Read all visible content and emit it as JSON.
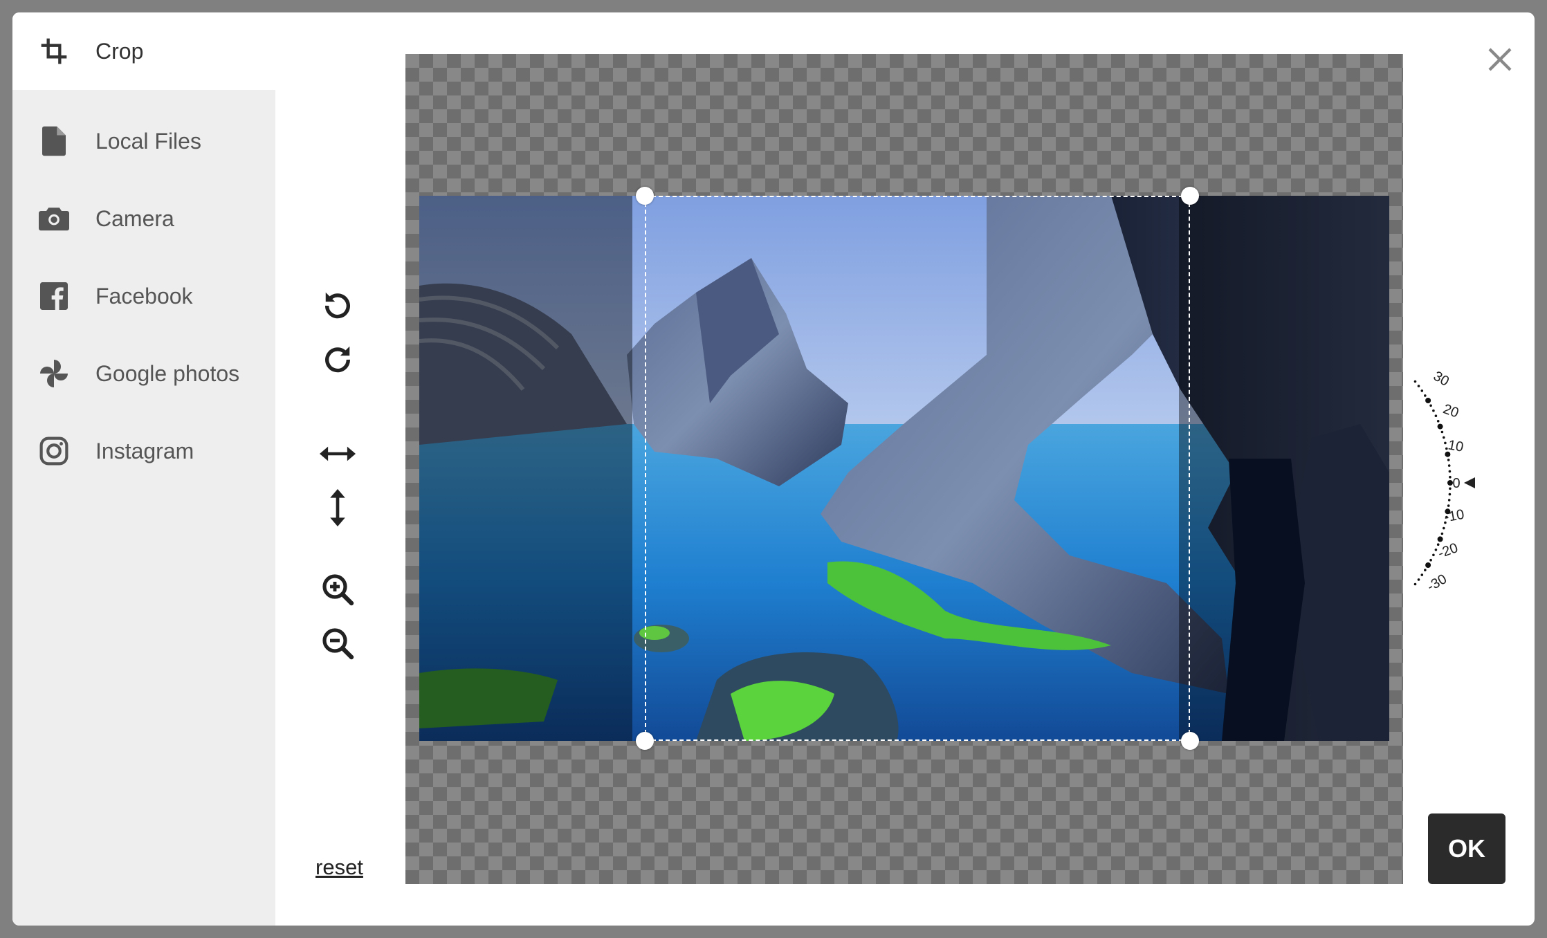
{
  "sidebar": {
    "items": [
      {
        "label": "Crop",
        "icon": "crop-icon",
        "active": true
      },
      {
        "label": "Local Files",
        "icon": "file-icon"
      },
      {
        "label": "Camera",
        "icon": "camera-icon"
      },
      {
        "label": "Facebook",
        "icon": "facebook-icon"
      },
      {
        "label": "Google photos",
        "icon": "google-photos-icon"
      },
      {
        "label": "Instagram",
        "icon": "instagram-icon"
      }
    ]
  },
  "tools": {
    "rotate_left": "rotate-left-icon",
    "rotate_right": "rotate-right-icon",
    "flip_horizontal": "flip-horizontal-icon",
    "flip_vertical": "flip-vertical-icon",
    "zoom_in": "zoom-in-icon",
    "zoom_out": "zoom-out-icon",
    "reset_label": "reset"
  },
  "rotation_dial": {
    "labels": [
      "30",
      "20",
      "10",
      "0",
      "-10",
      "-20",
      "-30"
    ],
    "current": 0
  },
  "actions": {
    "ok_label": "OK",
    "close_icon": "close-icon"
  },
  "colors": {
    "ok_button": "#2b2b2b",
    "sidebar_bg": "#eeeeee",
    "overlay": "#808080"
  }
}
